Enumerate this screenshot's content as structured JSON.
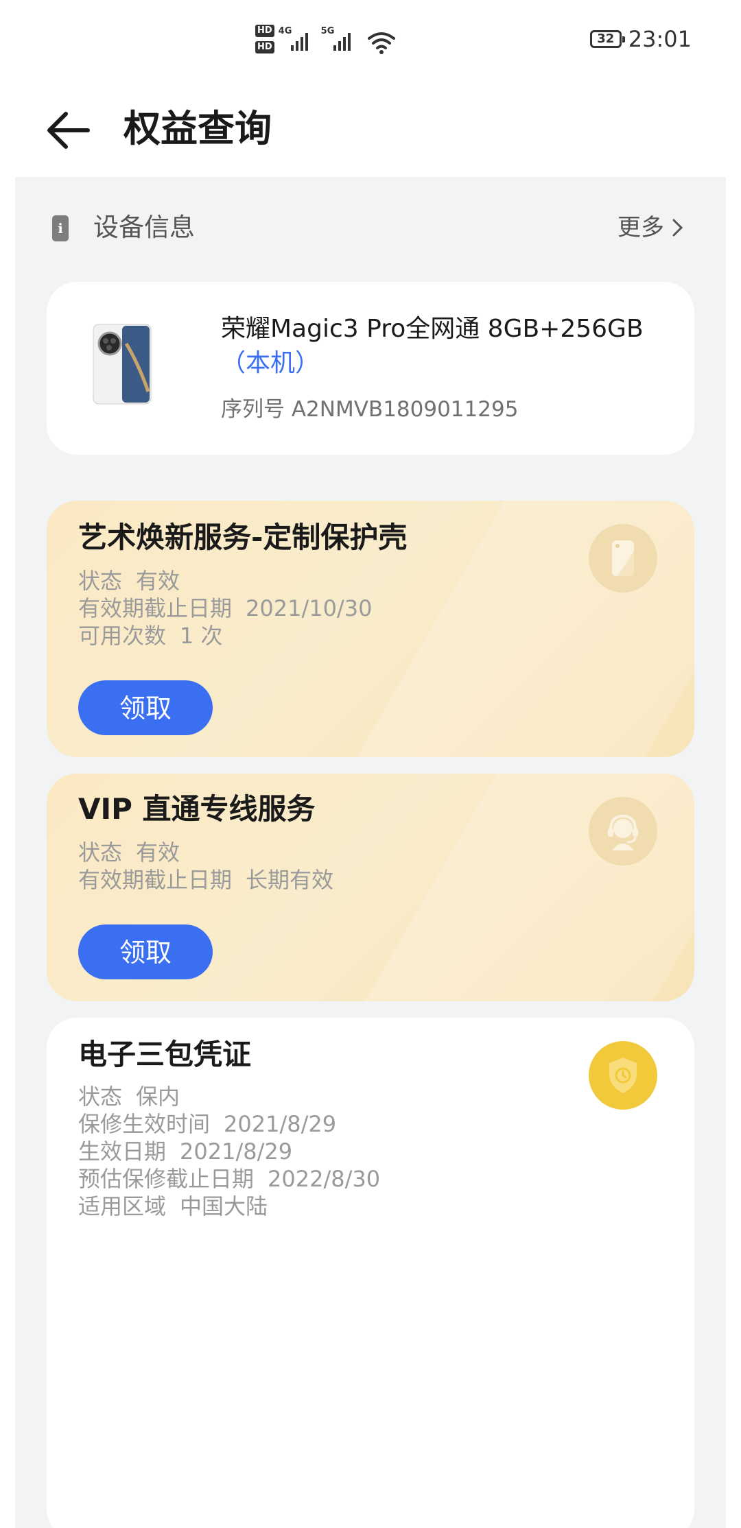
{
  "status_bar": {
    "sim1": "HD",
    "sim2": "HD",
    "net1": "4G",
    "net2": "5G",
    "battery": "32",
    "time": "23:01"
  },
  "header": {
    "title": "权益查询"
  },
  "device_section": {
    "title": "设备信息",
    "more": "更多",
    "device_name": "荣耀Magic3 Pro全网通 8GB+256GB",
    "this_device_tag": "（本机）",
    "serial": "序列号 A2NMVB1809011295"
  },
  "cards": [
    {
      "title": "艺术焕新服务-定制保护壳",
      "icon": "phone-case-icon",
      "rows": [
        {
          "label": "状态",
          "value": "有效"
        },
        {
          "label": "有效期截止日期",
          "value": "2021/10/30"
        },
        {
          "label": "可用次数",
          "value": "1 次"
        }
      ],
      "button": "领取"
    },
    {
      "title": "VIP 直通专线服务",
      "icon": "headset-agent-icon",
      "rows": [
        {
          "label": "状态",
          "value": "有效"
        },
        {
          "label": "有效期截止日期",
          "value": "长期有效"
        }
      ],
      "button": "领取"
    },
    {
      "title": "电子三包凭证",
      "icon": "shield-clock-icon",
      "rows": [
        {
          "label": "状态",
          "value": "保内"
        },
        {
          "label": "保修生效时间",
          "value": "2021/8/29"
        },
        {
          "label": "生效日期",
          "value": "2021/8/29"
        },
        {
          "label": "预估保修截止日期",
          "value": "2022/8/30"
        },
        {
          "label": "适用区域",
          "value": "中国大陆"
        }
      ]
    }
  ],
  "colors": {
    "accent": "#3b6ff2",
    "gold_card": "#fbe9c4",
    "badge_yellow": "#f2c93a"
  }
}
